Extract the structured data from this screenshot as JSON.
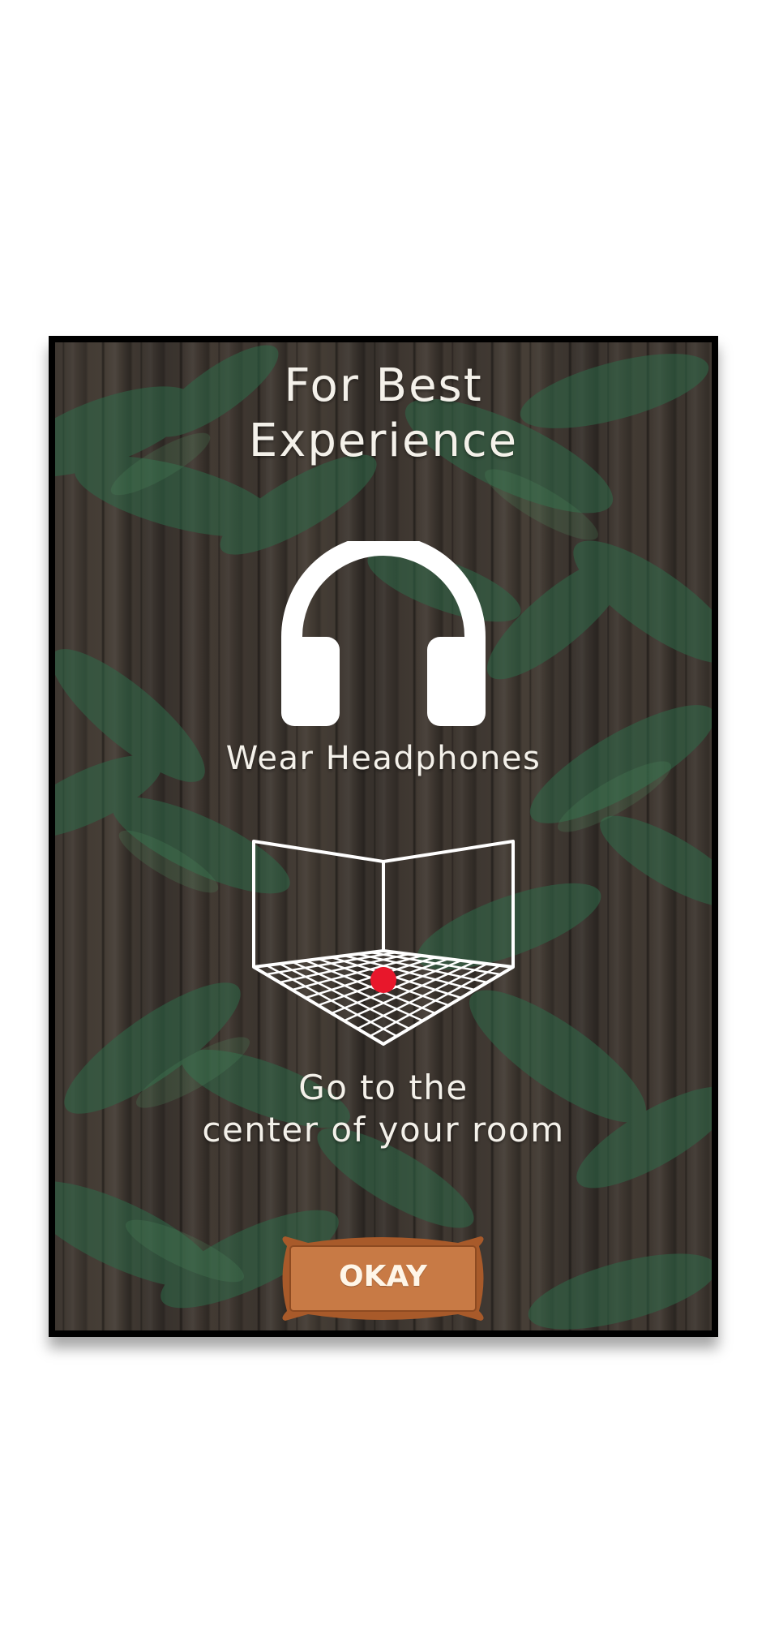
{
  "dialog": {
    "title": "For Best\nExperience",
    "headphones_caption": "Wear Headphones",
    "room_caption": "Go to the\ncenter of your room",
    "okay_label": "OKAY"
  },
  "icons": {
    "headphones": "headphones-icon",
    "room": "room-grid-icon",
    "center_dot": "center-position-dot"
  },
  "colors": {
    "text": "#f4f1ea",
    "wood_base": "#3b3530",
    "button_fill": "#c87a45",
    "button_frame": "#a85a2a",
    "center_dot": "#e8172b"
  }
}
